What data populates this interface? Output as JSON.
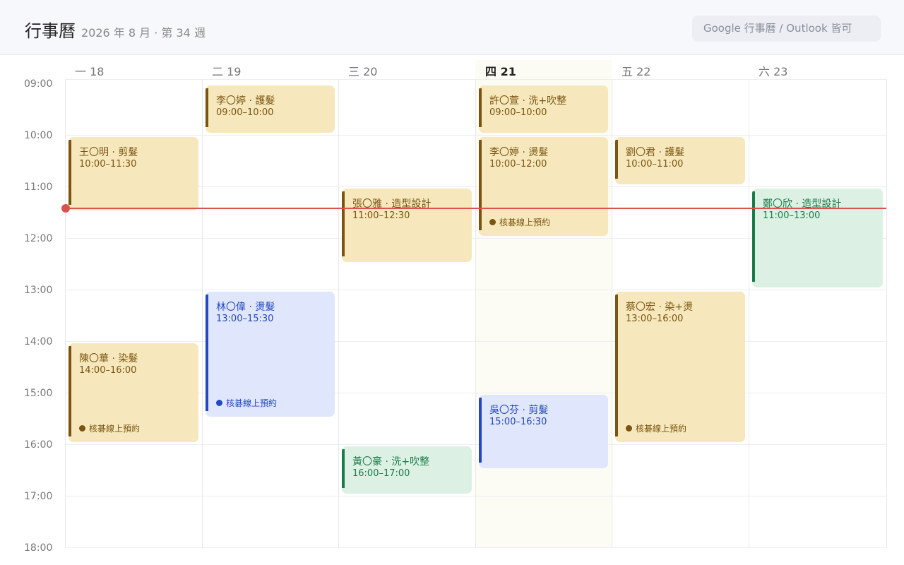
{
  "header": {
    "title": "行事曆",
    "subtitle": "2026 年 8 月 · 第 34 週",
    "source_hint": "Google 行事曆 / Outlook 皆可"
  },
  "days": [
    {
      "label": "一 18",
      "today": false
    },
    {
      "label": "二 19",
      "today": false
    },
    {
      "label": "三 20",
      "today": false
    },
    {
      "label": "四 21",
      "today": true
    },
    {
      "label": "五 22",
      "today": false
    },
    {
      "label": "六 23",
      "today": false
    }
  ],
  "hours": [
    "09:00",
    "10:00",
    "11:00",
    "12:00",
    "13:00",
    "14:00",
    "15:00",
    "16:00",
    "17:00",
    "18:00"
  ],
  "now_time": "11:24",
  "events": [
    {
      "day": 0,
      "title": "王〇明 · 剪髮",
      "time": "10:00–11:30",
      "start": "10:00",
      "end": "11:30",
      "color": "yellow",
      "status": ""
    },
    {
      "day": 0,
      "title": "陳〇華 · 染髮",
      "time": "14:00–16:00",
      "start": "14:00",
      "end": "16:00",
      "color": "yellow",
      "status": "核碁線上預約"
    },
    {
      "day": 1,
      "title": "李〇婷 · 護髮",
      "time": "09:00–10:00",
      "start": "09:00",
      "end": "10:00",
      "color": "yellow",
      "status": ""
    },
    {
      "day": 1,
      "title": "林〇偉 · 燙髮",
      "time": "13:00–15:30",
      "start": "13:00",
      "end": "15:30",
      "color": "blue",
      "status": "核碁線上預約"
    },
    {
      "day": 2,
      "title": "張〇雅 · 造型設計",
      "time": "11:00–12:30",
      "start": "11:00",
      "end": "12:30",
      "color": "yellow",
      "status": ""
    },
    {
      "day": 2,
      "title": "黃〇豪 · 洗+吹整",
      "time": "16:00–17:00",
      "start": "16:00",
      "end": "17:00",
      "color": "green",
      "status": ""
    },
    {
      "day": 3,
      "title": "許〇萱 · 洗+吹整",
      "time": "09:00–10:00",
      "start": "09:00",
      "end": "10:00",
      "color": "yellow",
      "status": ""
    },
    {
      "day": 3,
      "title": "李〇婷 · 燙髮",
      "time": "10:00–12:00",
      "start": "10:00",
      "end": "12:00",
      "color": "yellow",
      "status": "核碁線上預約"
    },
    {
      "day": 3,
      "title": "吳〇芬 · 剪髮",
      "time": "15:00–16:30",
      "start": "15:00",
      "end": "16:30",
      "color": "blue",
      "status": ""
    },
    {
      "day": 4,
      "title": "劉〇君 · 護髮",
      "time": "10:00–11:00",
      "start": "10:00",
      "end": "11:00",
      "color": "yellow",
      "status": ""
    },
    {
      "day": 4,
      "title": "蔡〇宏 · 染+燙",
      "time": "13:00–16:00",
      "start": "13:00",
      "end": "16:00",
      "color": "yellow",
      "status": "核碁線上預約"
    },
    {
      "day": 5,
      "title": "鄭〇欣 · 造型設計",
      "time": "11:00–13:00",
      "start": "11:00",
      "end": "13:00",
      "color": "green",
      "status": ""
    }
  ]
}
